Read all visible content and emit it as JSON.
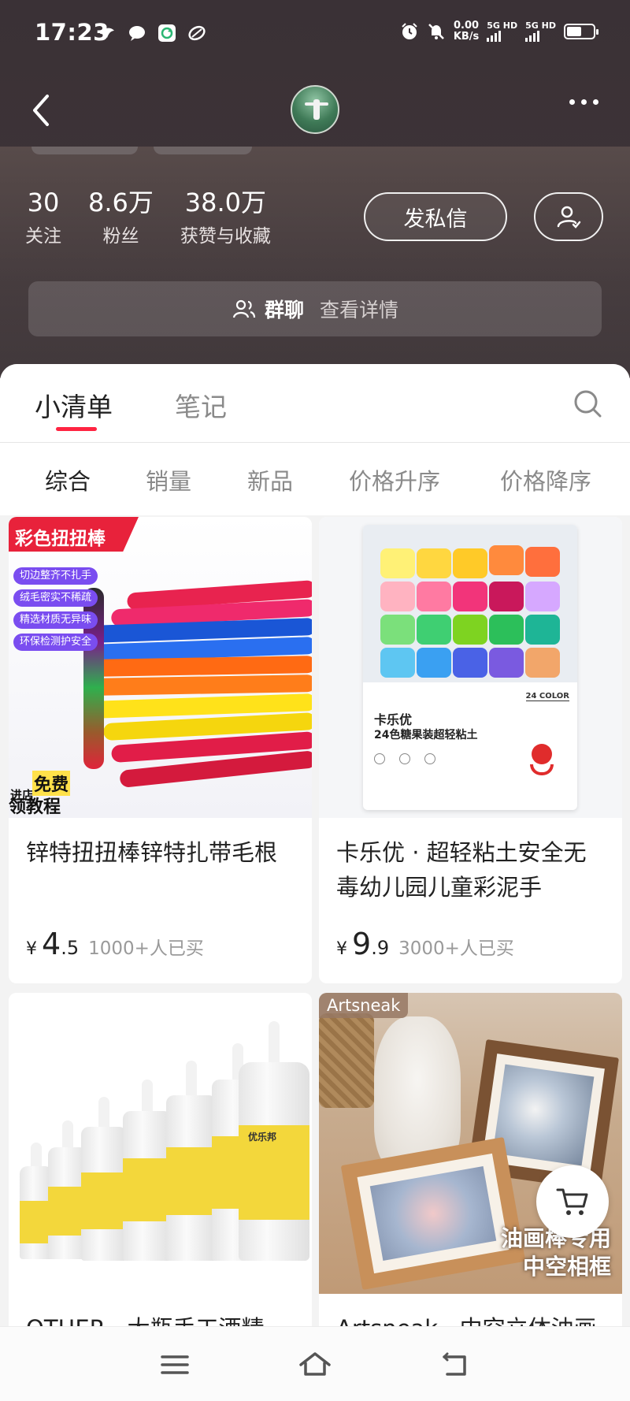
{
  "status_bar": {
    "time": "17:23",
    "net_speed_value": "0.00",
    "net_speed_unit": "KB/s",
    "sim1": "5G HD",
    "sim2": "5G HD"
  },
  "profile": {
    "stats": [
      {
        "value": "30",
        "label": "关注"
      },
      {
        "value": "8.6万",
        "label": "粉丝"
      },
      {
        "value": "38.0万",
        "label": "获赞与收藏"
      }
    ],
    "message_button": "发私信",
    "group_chat": {
      "label": "群聊",
      "detail": "查看详情"
    }
  },
  "tabs": [
    {
      "label": "小清单",
      "active": true
    },
    {
      "label": "笔记",
      "active": false
    }
  ],
  "sort_options": [
    {
      "label": "综合",
      "active": true
    },
    {
      "label": "销量",
      "active": false
    },
    {
      "label": "新品",
      "active": false
    },
    {
      "label": "价格升序",
      "active": false
    },
    {
      "label": "价格降序",
      "active": false
    }
  ],
  "products": [
    {
      "title": "锌特扭扭棒锌特扎带毛根",
      "price_symbol": "¥",
      "price_int": "4",
      "price_dec": ".5",
      "sold": "1000+人已买",
      "image": {
        "banner": "彩色扭扭棒",
        "pills": [
          "切边整齐不扎手",
          "绒毛密实不稀疏",
          "精选材质无异味",
          "环保检测护安全"
        ],
        "badge_small": "进店",
        "badge_free": "免费",
        "badge_tutorial": "领教程"
      }
    },
    {
      "title": "卡乐优 · 超轻粘土安全无毒幼儿园儿童彩泥手",
      "price_symbol": "¥",
      "price_int": "9",
      "price_dec": ".9",
      "sold": "3000+人已买",
      "image": {
        "brand": "卡乐优",
        "desc": "24色糖果装超轻粘土",
        "color_tag": "24 COLOR"
      }
    },
    {
      "title": "OTHER · 大瓶手工酒精",
      "image": {
        "label_text": "优乐邦"
      }
    },
    {
      "title": "Artsneak · 中空立体油画",
      "image": {
        "brand_tag": "Artsneak",
        "overlay_line1": "油画棒专用",
        "overlay_line2": "中空相框"
      }
    }
  ],
  "colors": {
    "accent": "#ff2442",
    "header_bg": "#3a3136"
  },
  "icons": {
    "back": "chevron-left-icon",
    "more": "more-dots-icon",
    "follow": "user-check-icon",
    "group": "group-users-icon",
    "search": "search-icon",
    "cart": "cart-icon",
    "nav_menu": "menu-icon",
    "nav_home": "home-icon",
    "nav_back": "back-icon"
  }
}
